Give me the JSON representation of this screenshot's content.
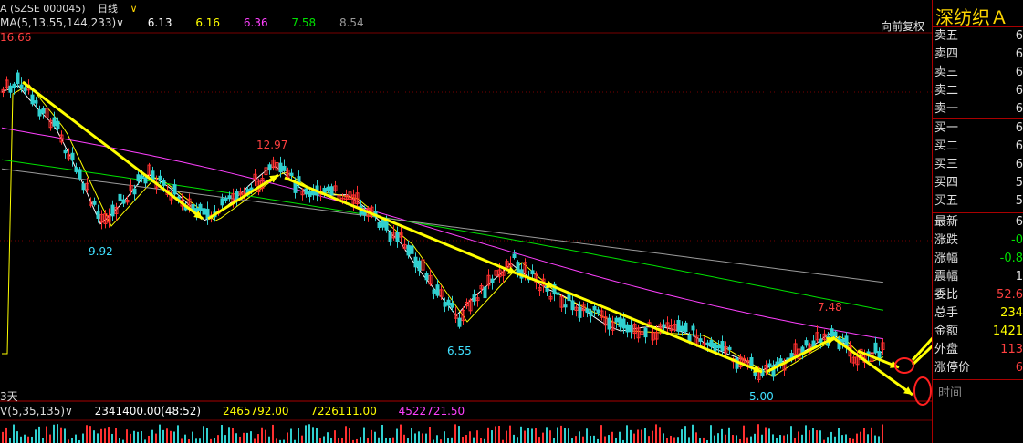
{
  "ticker": {
    "code_label": "A (SZSE 000045)",
    "period": "日线",
    "arrow": "∨"
  },
  "ma": {
    "label": "MA(5,13,55,144,233)∨",
    "values": [
      {
        "v": "6.13",
        "color": "#ffffff"
      },
      {
        "v": "6.16",
        "color": "#ffff00"
      },
      {
        "v": "6.36",
        "color": "#ff40ff"
      },
      {
        "v": "7.58",
        "color": "#00e000"
      },
      {
        "v": "8.54",
        "color": "#9a9a9a"
      }
    ]
  },
  "fuquan": "向前复权",
  "annotations": [
    {
      "text": "16.66",
      "color": "#ff4040"
    },
    {
      "text": "9.92",
      "color": "#40e0ff"
    },
    {
      "text": "12.97",
      "color": "#ff4040"
    },
    {
      "text": "6.55",
      "color": "#40e0ff"
    },
    {
      "text": "7.48",
      "color": "#ff4040"
    },
    {
      "text": "5.00",
      "color": "#40e0ff"
    }
  ],
  "days_label": "3天",
  "volume": {
    "label": "V(5,35,135)∨",
    "values": [
      {
        "v": "2341400.00(48:52)",
        "color": "#ffffff"
      },
      {
        "v": "2465792.00",
        "color": "#ffff00"
      },
      {
        "v": "7226111.00",
        "color": "#ffff00"
      },
      {
        "v": "4522721.50",
        "color": "#ff40ff"
      }
    ]
  },
  "panel": {
    "stock_name": "深纺织Ａ",
    "sell_rows": [
      {
        "label": "卖五",
        "value": "6"
      },
      {
        "label": "卖四",
        "value": "6"
      },
      {
        "label": "卖三",
        "value": "6"
      },
      {
        "label": "卖二",
        "value": "6"
      },
      {
        "label": "卖一",
        "value": "6"
      }
    ],
    "buy_rows": [
      {
        "label": "买一",
        "value": "6"
      },
      {
        "label": "买二",
        "value": "6"
      },
      {
        "label": "买三",
        "value": "6"
      },
      {
        "label": "买四",
        "value": "5"
      },
      {
        "label": "买五",
        "value": "5"
      }
    ],
    "stat_rows": [
      {
        "label": "最新",
        "value": "6",
        "color": "#e0e0e0"
      },
      {
        "label": "涨跌",
        "value": "-0",
        "color": "#00e000"
      },
      {
        "label": "涨幅",
        "value": "-0.8",
        "color": "#00e000"
      },
      {
        "label": "震幅",
        "value": "1",
        "color": "#e0e0e0"
      },
      {
        "label": "委比",
        "value": "52.6",
        "color": "#ff4040"
      },
      {
        "label": "总手",
        "value": "234",
        "color": "#ffff00"
      },
      {
        "label": "金额",
        "value": "1421",
        "color": "#ffff00"
      },
      {
        "label": "外盘",
        "value": "113",
        "color": "#ff4040"
      },
      {
        "label": "涨停价",
        "value": "6",
        "color": "#ff4040"
      }
    ],
    "time_label": "时间"
  },
  "colors": {
    "up": "#ff3030",
    "down": "#30d0d0",
    "trend": "#ffff00",
    "ma5": "#ffffff",
    "ma13": "#ffff00",
    "ma55": "#ff40ff",
    "ma144": "#00e000",
    "ma233": "#9a9a9a"
  }
}
